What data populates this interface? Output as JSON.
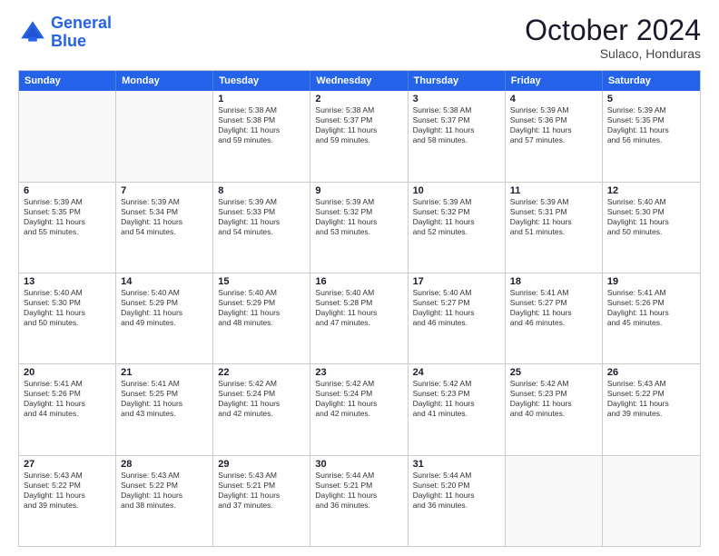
{
  "logo": {
    "line1": "General",
    "line2": "Blue"
  },
  "title": "October 2024",
  "subtitle": "Sulaco, Honduras",
  "header_days": [
    "Sunday",
    "Monday",
    "Tuesday",
    "Wednesday",
    "Thursday",
    "Friday",
    "Saturday"
  ],
  "weeks": [
    [
      {
        "day": "",
        "lines": []
      },
      {
        "day": "",
        "lines": []
      },
      {
        "day": "1",
        "lines": [
          "Sunrise: 5:38 AM",
          "Sunset: 5:38 PM",
          "Daylight: 11 hours",
          "and 59 minutes."
        ]
      },
      {
        "day": "2",
        "lines": [
          "Sunrise: 5:38 AM",
          "Sunset: 5:37 PM",
          "Daylight: 11 hours",
          "and 59 minutes."
        ]
      },
      {
        "day": "3",
        "lines": [
          "Sunrise: 5:38 AM",
          "Sunset: 5:37 PM",
          "Daylight: 11 hours",
          "and 58 minutes."
        ]
      },
      {
        "day": "4",
        "lines": [
          "Sunrise: 5:39 AM",
          "Sunset: 5:36 PM",
          "Daylight: 11 hours",
          "and 57 minutes."
        ]
      },
      {
        "day": "5",
        "lines": [
          "Sunrise: 5:39 AM",
          "Sunset: 5:35 PM",
          "Daylight: 11 hours",
          "and 56 minutes."
        ]
      }
    ],
    [
      {
        "day": "6",
        "lines": [
          "Sunrise: 5:39 AM",
          "Sunset: 5:35 PM",
          "Daylight: 11 hours",
          "and 55 minutes."
        ]
      },
      {
        "day": "7",
        "lines": [
          "Sunrise: 5:39 AM",
          "Sunset: 5:34 PM",
          "Daylight: 11 hours",
          "and 54 minutes."
        ]
      },
      {
        "day": "8",
        "lines": [
          "Sunrise: 5:39 AM",
          "Sunset: 5:33 PM",
          "Daylight: 11 hours",
          "and 54 minutes."
        ]
      },
      {
        "day": "9",
        "lines": [
          "Sunrise: 5:39 AM",
          "Sunset: 5:32 PM",
          "Daylight: 11 hours",
          "and 53 minutes."
        ]
      },
      {
        "day": "10",
        "lines": [
          "Sunrise: 5:39 AM",
          "Sunset: 5:32 PM",
          "Daylight: 11 hours",
          "and 52 minutes."
        ]
      },
      {
        "day": "11",
        "lines": [
          "Sunrise: 5:39 AM",
          "Sunset: 5:31 PM",
          "Daylight: 11 hours",
          "and 51 minutes."
        ]
      },
      {
        "day": "12",
        "lines": [
          "Sunrise: 5:40 AM",
          "Sunset: 5:30 PM",
          "Daylight: 11 hours",
          "and 50 minutes."
        ]
      }
    ],
    [
      {
        "day": "13",
        "lines": [
          "Sunrise: 5:40 AM",
          "Sunset: 5:30 PM",
          "Daylight: 11 hours",
          "and 50 minutes."
        ]
      },
      {
        "day": "14",
        "lines": [
          "Sunrise: 5:40 AM",
          "Sunset: 5:29 PM",
          "Daylight: 11 hours",
          "and 49 minutes."
        ]
      },
      {
        "day": "15",
        "lines": [
          "Sunrise: 5:40 AM",
          "Sunset: 5:29 PM",
          "Daylight: 11 hours",
          "and 48 minutes."
        ]
      },
      {
        "day": "16",
        "lines": [
          "Sunrise: 5:40 AM",
          "Sunset: 5:28 PM",
          "Daylight: 11 hours",
          "and 47 minutes."
        ]
      },
      {
        "day": "17",
        "lines": [
          "Sunrise: 5:40 AM",
          "Sunset: 5:27 PM",
          "Daylight: 11 hours",
          "and 46 minutes."
        ]
      },
      {
        "day": "18",
        "lines": [
          "Sunrise: 5:41 AM",
          "Sunset: 5:27 PM",
          "Daylight: 11 hours",
          "and 46 minutes."
        ]
      },
      {
        "day": "19",
        "lines": [
          "Sunrise: 5:41 AM",
          "Sunset: 5:26 PM",
          "Daylight: 11 hours",
          "and 45 minutes."
        ]
      }
    ],
    [
      {
        "day": "20",
        "lines": [
          "Sunrise: 5:41 AM",
          "Sunset: 5:26 PM",
          "Daylight: 11 hours",
          "and 44 minutes."
        ]
      },
      {
        "day": "21",
        "lines": [
          "Sunrise: 5:41 AM",
          "Sunset: 5:25 PM",
          "Daylight: 11 hours",
          "and 43 minutes."
        ]
      },
      {
        "day": "22",
        "lines": [
          "Sunrise: 5:42 AM",
          "Sunset: 5:24 PM",
          "Daylight: 11 hours",
          "and 42 minutes."
        ]
      },
      {
        "day": "23",
        "lines": [
          "Sunrise: 5:42 AM",
          "Sunset: 5:24 PM",
          "Daylight: 11 hours",
          "and 42 minutes."
        ]
      },
      {
        "day": "24",
        "lines": [
          "Sunrise: 5:42 AM",
          "Sunset: 5:23 PM",
          "Daylight: 11 hours",
          "and 41 minutes."
        ]
      },
      {
        "day": "25",
        "lines": [
          "Sunrise: 5:42 AM",
          "Sunset: 5:23 PM",
          "Daylight: 11 hours",
          "and 40 minutes."
        ]
      },
      {
        "day": "26",
        "lines": [
          "Sunrise: 5:43 AM",
          "Sunset: 5:22 PM",
          "Daylight: 11 hours",
          "and 39 minutes."
        ]
      }
    ],
    [
      {
        "day": "27",
        "lines": [
          "Sunrise: 5:43 AM",
          "Sunset: 5:22 PM",
          "Daylight: 11 hours",
          "and 39 minutes."
        ]
      },
      {
        "day": "28",
        "lines": [
          "Sunrise: 5:43 AM",
          "Sunset: 5:22 PM",
          "Daylight: 11 hours",
          "and 38 minutes."
        ]
      },
      {
        "day": "29",
        "lines": [
          "Sunrise: 5:43 AM",
          "Sunset: 5:21 PM",
          "Daylight: 11 hours",
          "and 37 minutes."
        ]
      },
      {
        "day": "30",
        "lines": [
          "Sunrise: 5:44 AM",
          "Sunset: 5:21 PM",
          "Daylight: 11 hours",
          "and 36 minutes."
        ]
      },
      {
        "day": "31",
        "lines": [
          "Sunrise: 5:44 AM",
          "Sunset: 5:20 PM",
          "Daylight: 11 hours",
          "and 36 minutes."
        ]
      },
      {
        "day": "",
        "lines": []
      },
      {
        "day": "",
        "lines": []
      }
    ]
  ]
}
